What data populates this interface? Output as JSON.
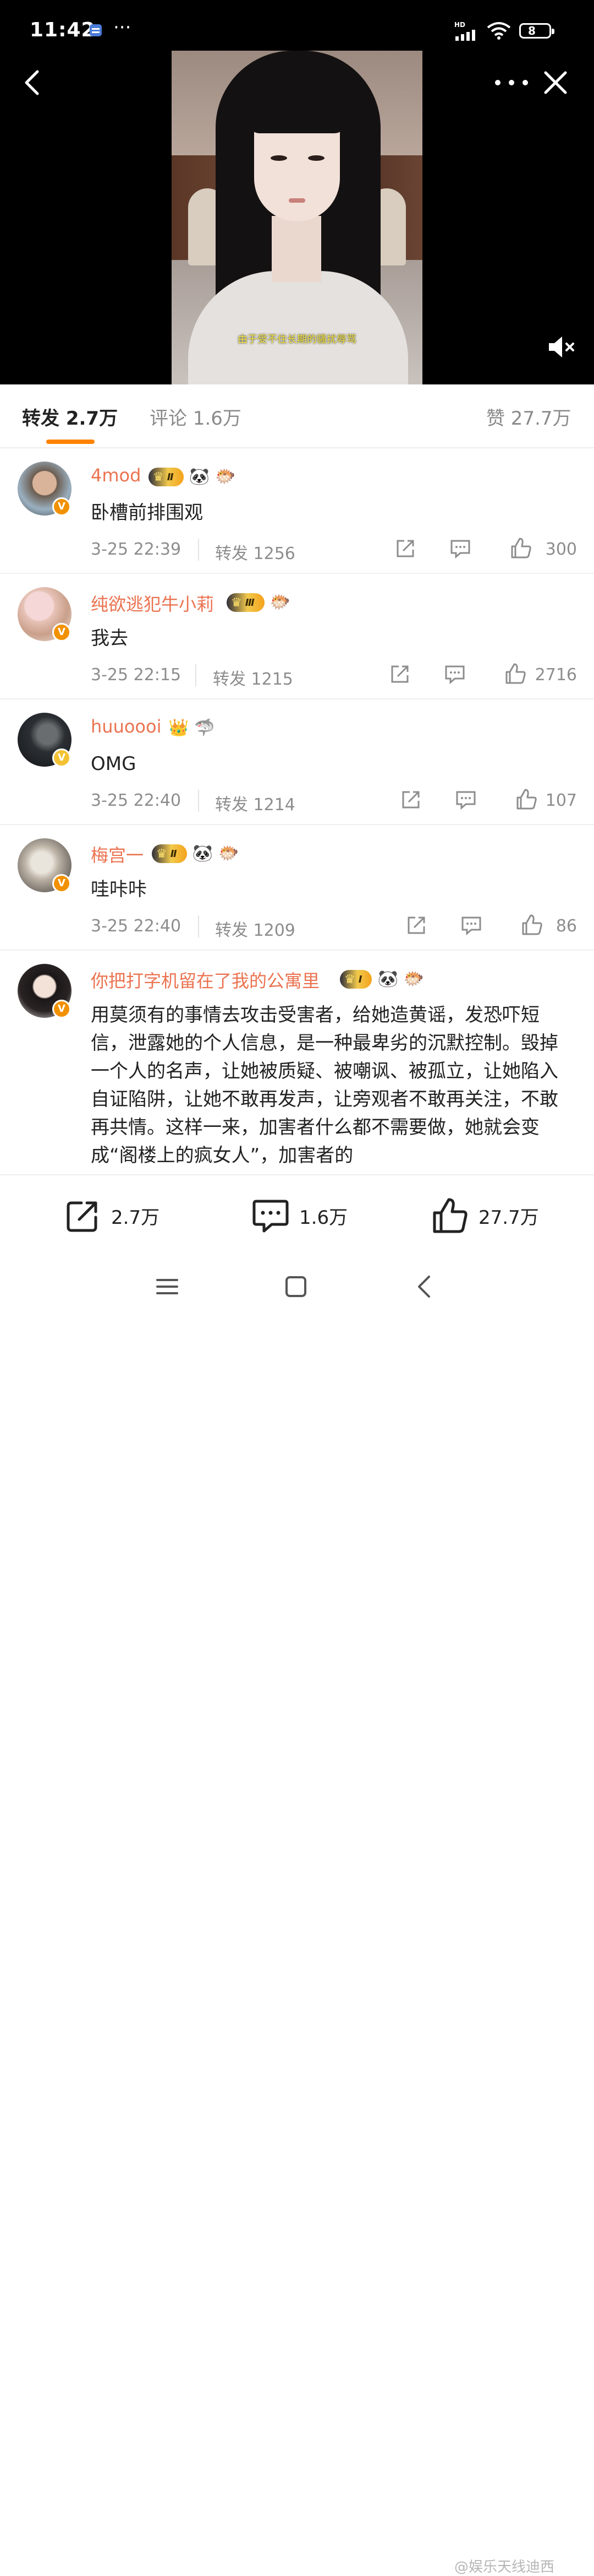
{
  "status_bar": {
    "time": "11:42",
    "dots": "···",
    "network": "HD",
    "battery": "8"
  },
  "video": {
    "subtitle": "由于受不住长期的骚扰辱骂",
    "muted": true
  },
  "tabs": [
    {
      "label": "转发 2.7万",
      "active": true
    },
    {
      "label": "评论 1.6万",
      "active": false
    },
    {
      "label": "赞 27.7万",
      "active": false
    }
  ],
  "reposts": [
    {
      "name": "4mod",
      "level": "Ⅱ",
      "extra_emojis": [
        "🐼",
        "🐡"
      ],
      "verified": "orange",
      "content": "卧槽前排围观",
      "date": "3-25 22:39",
      "repost_label": "转发 1256",
      "likes": "300"
    },
    {
      "name": "纯欲逃犯牛小莉",
      "level": "Ⅲ",
      "extra_emojis": [
        "🐡"
      ],
      "verified": "orange",
      "content": "我去",
      "date": "3-25 22:15",
      "repost_label": "转发 1215",
      "likes": "2716"
    },
    {
      "name": "huuoooi",
      "level": "",
      "extra_emojis": [
        "👑",
        "🦈"
      ],
      "verified": "gold",
      "content": "OMG",
      "date": "3-25 22:40",
      "repost_label": "转发 1214",
      "likes": "107"
    },
    {
      "name": "梅宫一",
      "level": "Ⅱ",
      "extra_emojis": [
        "🐼",
        "🐡"
      ],
      "verified": "orange",
      "content": "哇咔咔",
      "date": "3-25 22:40",
      "repost_label": "转发 1209",
      "likes": "86"
    },
    {
      "name": "你把打字机留在了我的公寓里",
      "level": "Ⅰ",
      "extra_emojis": [
        "🐼",
        "🐡"
      ],
      "verified": "orange",
      "content": "用莫须有的事情去攻击受害者，给她造黄谣，发恐吓短信，泄露她的个人信息，是一种最卑劣的沉默控制。毁掉一个人的名声，让她被质疑、被嘲讽、被孤立，让她陷入自证陷阱，让她不敢再发声，让旁观者不敢再关注，不敢再共情。这样一来，加害者什么都不需要做，她就会变成“阁楼上的疯女人”，加害者的"
    }
  ],
  "action_bar": {
    "repost_count": "2.7万",
    "comment_count": "1.6万",
    "like_count": "27.7万"
  },
  "watermark": "@娱乐天线迪西"
}
